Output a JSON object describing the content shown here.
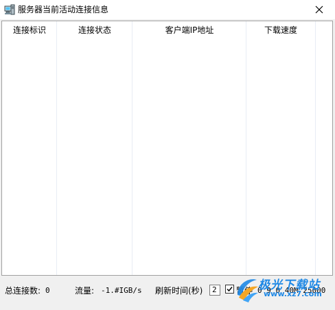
{
  "window": {
    "title": "服务器当前活动连接信息"
  },
  "listview": {
    "columns": [
      {
        "label": "连接标识"
      },
      {
        "label": "连接状态"
      },
      {
        "label": "客户端IP地址"
      },
      {
        "label": "下载速度"
      }
    ]
  },
  "statusbar": {
    "total_connections_label": "总连接数:",
    "total_connections_value": "0",
    "traffic_label": "流量:",
    "traffic_value": "-1.#IGB/s",
    "refresh_label": "刷新时间(秒)",
    "refresh_value": "2",
    "pause_label": "暂停",
    "pause_checked": true,
    "extra_values": "0 9 0 40M 25000"
  },
  "watermark": {
    "brand": "极光下载站",
    "url": "www.xz7.com"
  },
  "colors": {
    "watermark_blue": "#1e88e5",
    "watermark_orange": "#f5a623"
  }
}
